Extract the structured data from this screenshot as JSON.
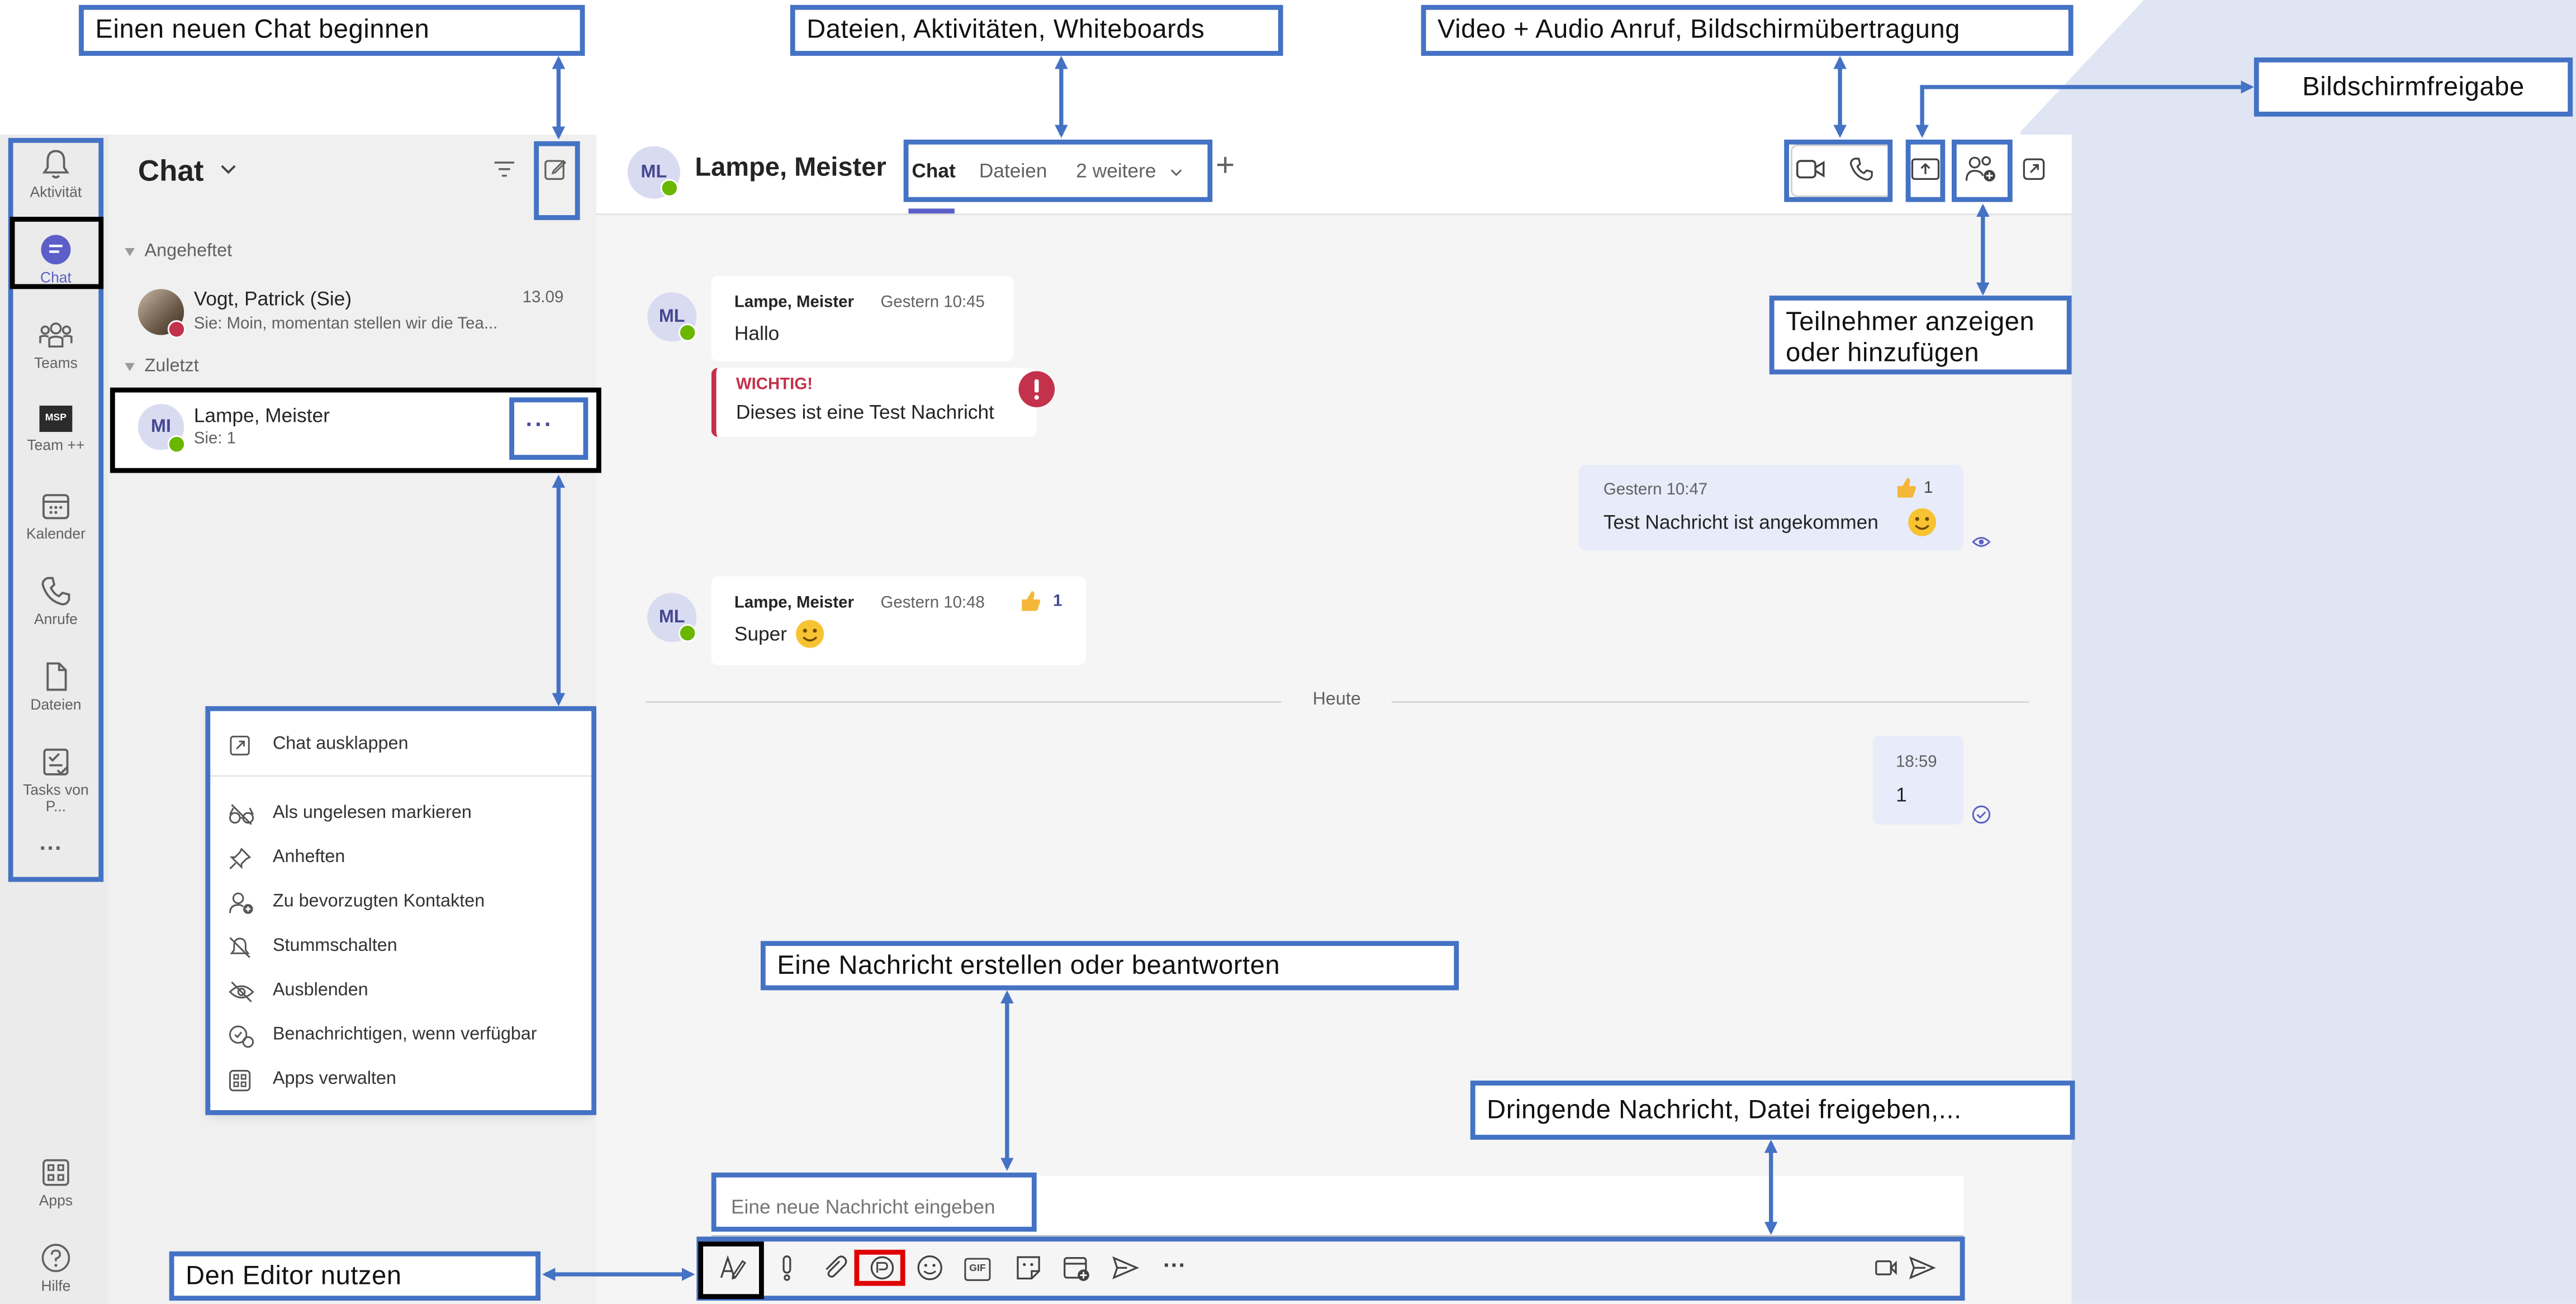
{
  "annotations": {
    "new_chat": "Einen neuen Chat beginnen",
    "tabs": "Dateien, Aktivitäten, Whiteboards",
    "calls": "Video + Audio Anruf, Bildschirmübertragung",
    "screen_share": "Bildschirmfreigabe",
    "participants_line1": "Teilnehmer anzeigen",
    "participants_line2": "oder hinzufügen",
    "compose": "Eine Nachricht erstellen oder beantworten",
    "urgent": "Dringende Nachricht, Datei freigeben,...",
    "editor": "Den Editor nutzen"
  },
  "rail": {
    "items": [
      {
        "label": "Aktivität",
        "icon": "bell-icon"
      },
      {
        "label": "Chat",
        "icon": "chat-icon"
      },
      {
        "label": "Teams",
        "icon": "teams-icon"
      },
      {
        "label": "Team ++",
        "icon": "msp-logo-icon",
        "logo_text": "MSP"
      },
      {
        "label": "Kalender",
        "icon": "calendar-icon"
      },
      {
        "label": "Anrufe",
        "icon": "phone-icon"
      },
      {
        "label": "Dateien",
        "icon": "file-icon"
      },
      {
        "label": "Tasks von P...",
        "icon": "tasks-icon"
      }
    ],
    "more": "···",
    "apps": "Apps",
    "help": "Hilfe"
  },
  "chatlist": {
    "title": "Chat",
    "pinned_header": "Angeheftet",
    "recent_header": "Zuletzt",
    "items": [
      {
        "name": "Vogt, Patrick (Sie)",
        "preview": "Sie: Moin, momentan stellen wir die Tea...",
        "time": "13.09"
      },
      {
        "name": "Lampe, Meister",
        "preview": "Sie: 1",
        "initials": "MI",
        "more": "···"
      }
    ]
  },
  "context_menu": [
    "Chat ausklappen",
    "Als ungelesen markieren",
    "Anheften",
    "Zu bevorzugten Kontakten",
    "Stummschalten",
    "Ausblenden",
    "Benachrichtigen, wenn verfügbar",
    "Apps verwalten"
  ],
  "header": {
    "initials": "ML",
    "name": "Lampe, Meister",
    "tabs": [
      "Chat",
      "Dateien",
      "2 weitere"
    ],
    "add": "+"
  },
  "messages": {
    "m1_sender": "Lampe, Meister",
    "m1_time": "Gestern 10:45",
    "m1_text": "Hallo",
    "m2_label": "WICHTIG!",
    "m2_text": "Dieses ist eine Test Nachricht",
    "m3_time": "Gestern 10:47",
    "m3_text": "Test Nachricht ist angekommen",
    "m3_reaction": "1",
    "m4_sender": "Lampe, Meister",
    "m4_time": "Gestern 10:48",
    "m4_text": "Super",
    "m4_reaction": "1",
    "divider": "Heute",
    "m5_time": "18:59",
    "m5_text": "1"
  },
  "compose": {
    "placeholder": "Eine neue Nachricht eingeben",
    "gif": "GIF",
    "more": "···"
  },
  "colors": {
    "annotation_border": "#4472c4",
    "accent": "#5b5fc7",
    "urgent": "#c4314b",
    "highlight_red": "#e00000"
  }
}
